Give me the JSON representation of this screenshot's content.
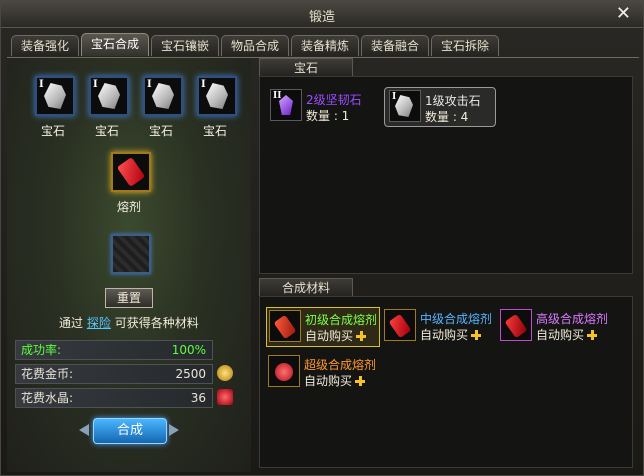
{
  "window": {
    "title": "锻造"
  },
  "tabs": [
    {
      "label": "装备强化",
      "active": false
    },
    {
      "label": "宝石合成",
      "active": true
    },
    {
      "label": "宝石镶嵌",
      "active": false
    },
    {
      "label": "物品合成",
      "active": false
    },
    {
      "label": "装备精炼",
      "active": false
    },
    {
      "label": "装备融合",
      "active": false
    },
    {
      "label": "宝石拆除",
      "active": false
    }
  ],
  "synth": {
    "gem_slots": [
      {
        "label": "宝石",
        "grade": "I"
      },
      {
        "label": "宝石",
        "grade": "I"
      },
      {
        "label": "宝石",
        "grade": "I"
      },
      {
        "label": "宝石",
        "grade": "I"
      }
    ],
    "flux_label": "熔剂",
    "reset_label": "重置",
    "hint_prefix": "通过",
    "hint_link": "探险",
    "hint_suffix": "可获得各种材料",
    "success_rate_label": "成功率:",
    "success_rate_value": "100%",
    "gold_label": "花费金币:",
    "gold_value": "2500",
    "crystal_label": "花费水晶:",
    "crystal_value": "36",
    "synth_button": "合成"
  },
  "gems_section": {
    "title": "宝石",
    "items": [
      {
        "grade": "II",
        "name": "2级坚韧石",
        "qty": "数量 : 1",
        "color": "#9a4cff"
      },
      {
        "grade": "I",
        "name": "1级攻击石",
        "qty": "数量 : 4",
        "color": "#e8e8e8"
      }
    ]
  },
  "materials_section": {
    "title": "合成材料",
    "items": [
      {
        "name": "初级合成熔剂",
        "buy": "自动购买",
        "name_color": "#7dff4e"
      },
      {
        "name": "中级合成熔剂",
        "buy": "自动购买",
        "name_color": "#58b4ff"
      },
      {
        "name": "高级合成熔剂",
        "buy": "自动购买",
        "name_color": "#d97aff"
      },
      {
        "name": "超级合成熔剂",
        "buy": "自动购买",
        "name_color": "#ff9a2e"
      }
    ]
  },
  "colors": {
    "success": "#5cff3a",
    "link": "#56c8ff",
    "accent": "#1467b0"
  }
}
